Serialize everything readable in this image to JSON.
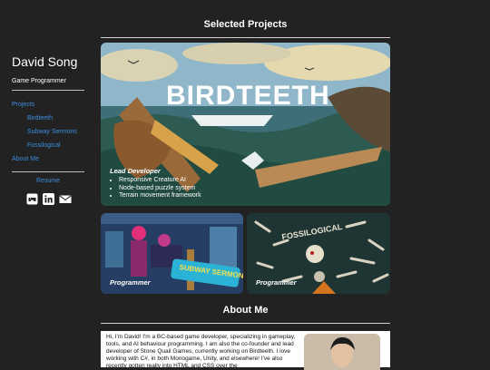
{
  "sidebar": {
    "name": "David Song",
    "role": "Game Programmer",
    "nav": [
      {
        "label": "Projects"
      },
      {
        "label": "Birdteeth"
      },
      {
        "label": "Subway Sermons"
      },
      {
        "label": "Fossilogical"
      },
      {
        "label": "About Me"
      }
    ],
    "resume": "Resume",
    "icons": [
      "game-controller-icon",
      "linkedin-icon",
      "email-icon"
    ]
  },
  "projects": {
    "title": "Selected Projects",
    "featured": {
      "name": "BIRDTEETH",
      "role": "Lead Developer",
      "bullets": [
        "Responsive Creature AI",
        "Node-based puzzle system",
        "Terrain movement framework"
      ]
    },
    "cards": [
      {
        "name": "SUBWAY SERMONS",
        "role": "Programmer"
      },
      {
        "name": "FOSSILOGICAL",
        "role": "Programmer"
      }
    ]
  },
  "about": {
    "title": "About Me",
    "text": "Hi, I'm David! I'm a BC-based game developer, specializing in gameplay, tools, and AI behaviour programming. I am also the co-founder and lead developer of Stone Quail Games, currently working on Birdteeth. I love working with C#, in both Monogame, Unity, and elsewhere! I've also recently gotten really into HTML and CSS over the"
  },
  "colors": {
    "background": "#222222",
    "link": "#3b8fe0"
  }
}
